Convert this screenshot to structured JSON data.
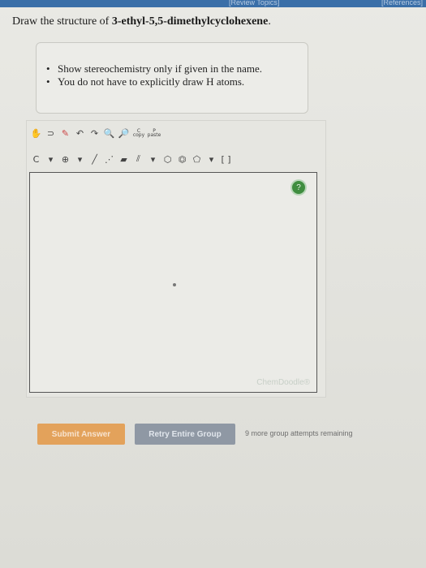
{
  "header": {
    "review_topics": "[Review Topics]",
    "references": "[References]"
  },
  "question": {
    "prefix": "Draw the structure of ",
    "name": "3-ethyl-5,5-dimethylcyclohexene",
    "suffix": "."
  },
  "hints": [
    "Show stereochemistry only if given in the name.",
    "You do not have to explicitly draw H atoms."
  ],
  "toolbar": {
    "element_label": "C",
    "charge_label": "⊕",
    "chain_label": "[ ]",
    "mark_label": "±",
    "clear_label_top": "C",
    "clear_label_bottom": "copy",
    "paste_label_top": "P",
    "paste_label_bottom": "paste"
  },
  "editor": {
    "help_label": "?",
    "watermark": "ChemDoodle®"
  },
  "actions": {
    "submit_label": "Submit Answer",
    "retry_label": "Retry Entire Group",
    "attempts_text": "9 more group attempts remaining"
  },
  "colors": {
    "submit": "#e3a25b",
    "retry": "#8f98a4",
    "help": "#3f8d3f",
    "topbar": "#3a6fa8"
  }
}
